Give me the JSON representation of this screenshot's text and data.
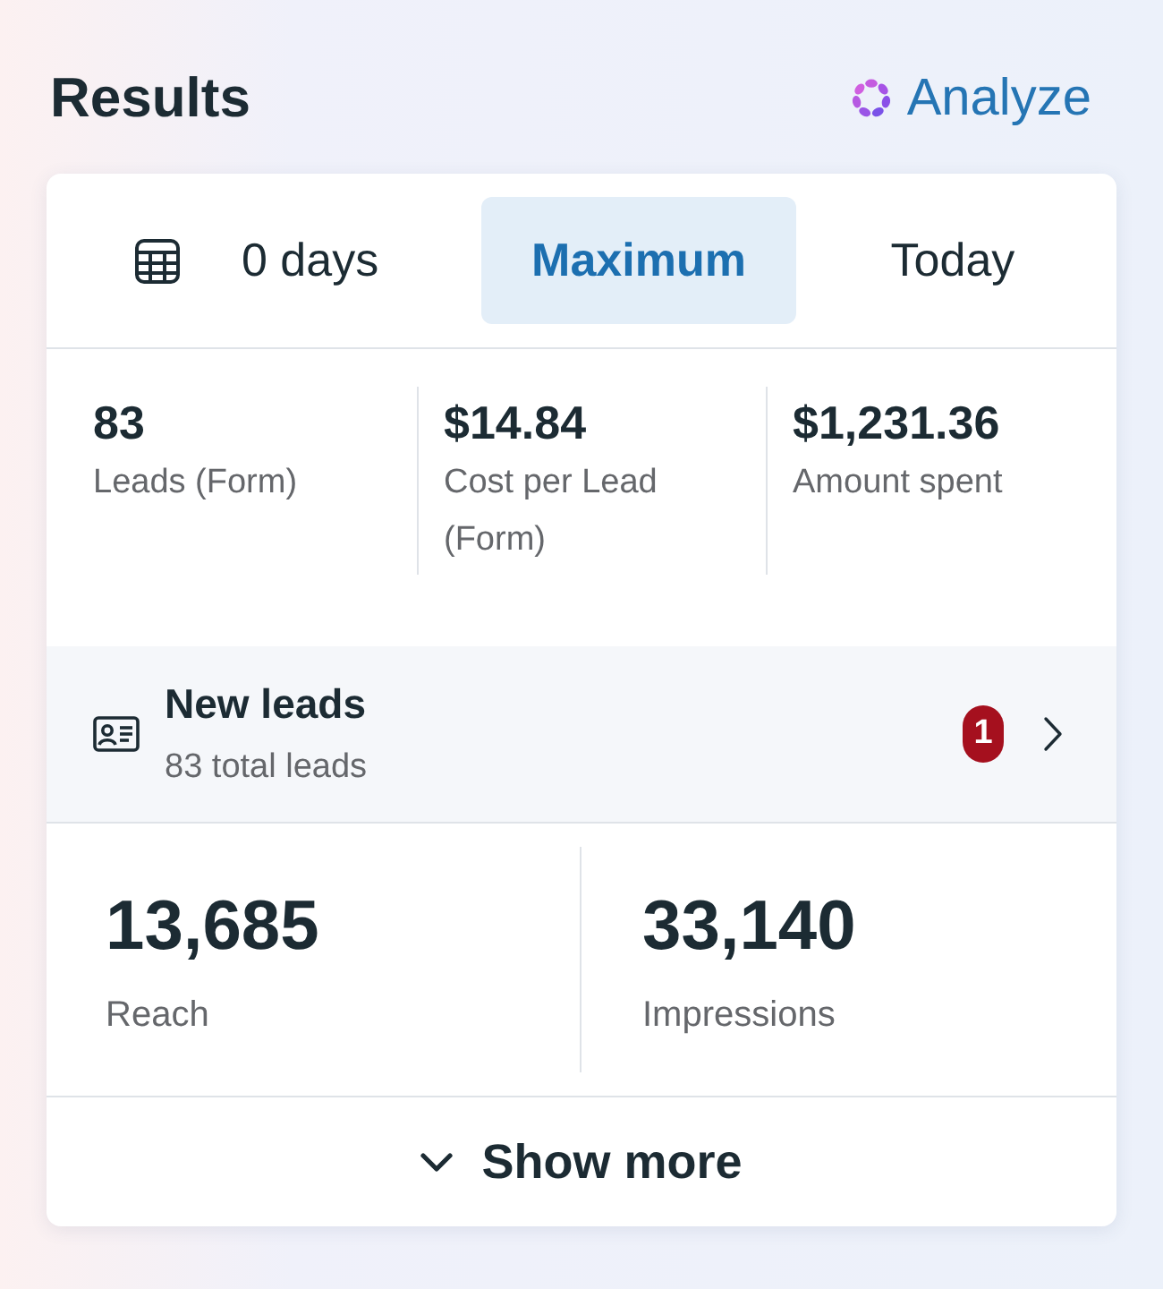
{
  "header": {
    "title": "Results",
    "action": "Analyze"
  },
  "tabs": [
    {
      "label": "0 days",
      "kind": "date",
      "selected": false
    },
    {
      "label": "Maximum",
      "kind": "text",
      "selected": true
    },
    {
      "label": "Today",
      "kind": "text",
      "selected": false
    }
  ],
  "metrics": [
    {
      "value": "83",
      "label": "Leads (Form)"
    },
    {
      "value": "$14.84",
      "label": "Cost per Lead (Form)"
    },
    {
      "value": "$1,231.36",
      "label": "Amount spent"
    }
  ],
  "leads": {
    "title": "New leads",
    "subtitle": "83 total leads",
    "badge": "1"
  },
  "stats": [
    {
      "value": "13,685",
      "label": "Reach"
    },
    {
      "value": "33,140",
      "label": "Impressions"
    }
  ],
  "show_more": "Show more"
}
